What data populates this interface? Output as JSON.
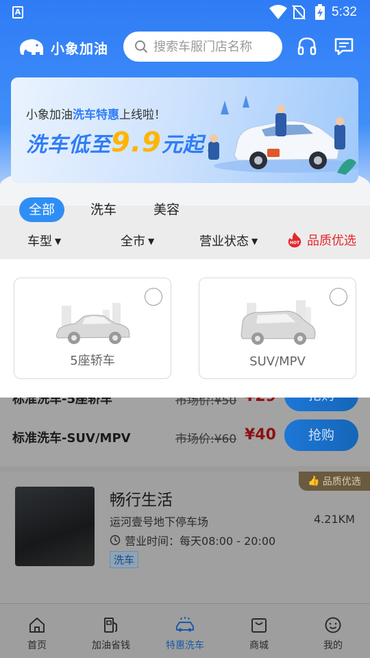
{
  "status_bar": {
    "time": "5:32"
  },
  "header": {
    "logo_text": "小象加油",
    "search_placeholder": "搜索车服门店名称"
  },
  "banner": {
    "line1_pre": "小象加油",
    "line1_highlight": "洗车特惠",
    "line1_post": "上线啦！",
    "line2_pre": "洗车低至",
    "line2_price": "9.9",
    "line2_post": "元起！"
  },
  "tabs": [
    {
      "label": "全部",
      "active": true
    },
    {
      "label": "洗车",
      "active": false
    },
    {
      "label": "美容",
      "active": false
    }
  ],
  "filters": {
    "car_type": "车型",
    "city": "全市",
    "business_status": "营业状态",
    "quality": "品质优选"
  },
  "car_options": [
    {
      "label": "5座轿车",
      "selected": false
    },
    {
      "label": "SUV/MPV",
      "selected": false
    }
  ],
  "services": [
    {
      "name": "标准洗车-5座轿车",
      "market": "市场价:¥50",
      "price": "¥29",
      "button": "抢购"
    },
    {
      "name": "标准洗车-SUV/MPV",
      "market": "市场价:¥60",
      "price": "¥40",
      "button": "抢购"
    }
  ],
  "store": {
    "badge": "品质优选",
    "name": "畅行生活",
    "address": "运河壹号地下停车场",
    "distance": "4.21KM",
    "hours_label": "营业时间：",
    "hours": "每天08:00 - 20:00",
    "tag": "洗车"
  },
  "bottom_nav": [
    {
      "label": "首页",
      "icon": "home-icon"
    },
    {
      "label": "加油省钱",
      "icon": "fuel-pump-icon"
    },
    {
      "label": "特惠洗车",
      "icon": "car-wash-icon",
      "active": true
    },
    {
      "label": "商城",
      "icon": "shopping-bag-icon"
    },
    {
      "label": "我的",
      "icon": "smiley-icon"
    }
  ],
  "colors": {
    "primary": "#2f7cf6",
    "price_red": "#e5262c",
    "promo_yellow": "#ffb400"
  }
}
